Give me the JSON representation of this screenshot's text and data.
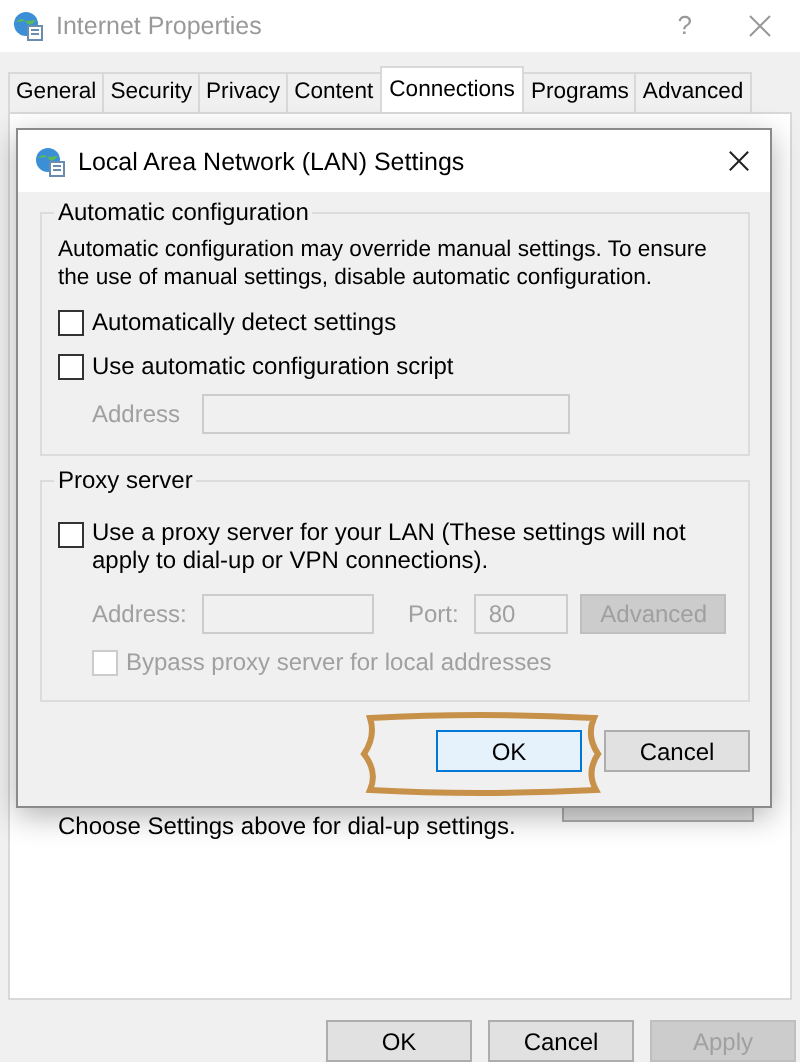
{
  "window": {
    "title": "Internet Properties",
    "help": "?"
  },
  "tabs": [
    {
      "label": "General",
      "selected": false
    },
    {
      "label": "Security",
      "selected": false
    },
    {
      "label": "Privacy",
      "selected": false
    },
    {
      "label": "Content",
      "selected": false
    },
    {
      "label": "Connections",
      "selected": true
    },
    {
      "label": "Programs",
      "selected": false
    },
    {
      "label": "Advanced",
      "selected": false
    }
  ],
  "panel": {
    "note": "Choose Settings above for dial-up settings."
  },
  "dialog": {
    "title": "Local Area Network (LAN) Settings",
    "auto_config": {
      "heading": "Automatic configuration",
      "description": "Automatic configuration may override manual settings.  To ensure the use of manual settings, disable automatic configuration.",
      "options": [
        {
          "label": "Automatically detect settings",
          "checked": false
        },
        {
          "label": "Use automatic configuration script",
          "checked": false
        }
      ],
      "address": {
        "label": "Address",
        "disabled": true
      }
    },
    "proxy": {
      "heading": "Proxy server",
      "option": {
        "label": "Use a proxy server for your LAN (These settings will not apply to dial-up or VPN connections).",
        "checked": false
      },
      "address": {
        "label": "Address:",
        "disabled": true
      },
      "port": {
        "label": "Port:",
        "value": "80",
        "disabled": true
      },
      "advanced": {
        "label": "Advanced",
        "disabled": true
      },
      "bypass": {
        "label": "Bypass proxy server for local addresses",
        "checked": false,
        "disabled": true
      }
    },
    "buttons": [
      {
        "label": "OK",
        "default": true
      },
      {
        "label": "Cancel",
        "default": false
      }
    ]
  },
  "buttons": [
    {
      "label": "OK",
      "disabled": false
    },
    {
      "label": "Cancel",
      "disabled": false
    },
    {
      "label": "Apply",
      "disabled": true
    }
  ]
}
